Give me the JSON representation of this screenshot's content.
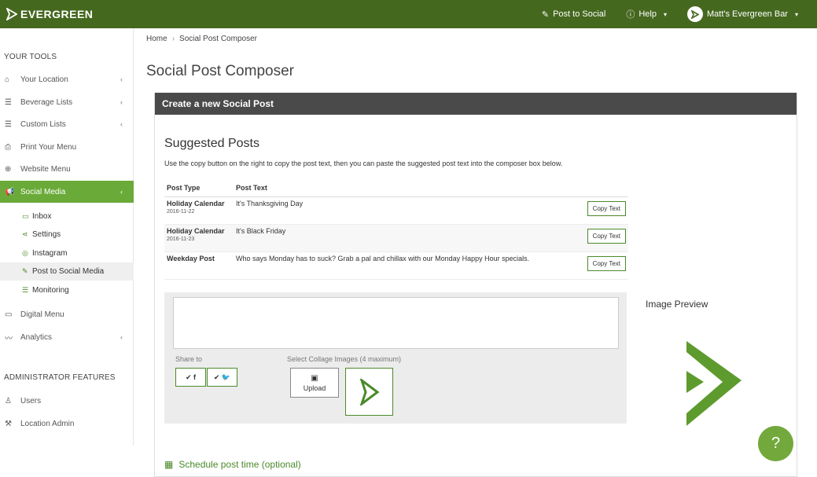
{
  "brand": {
    "name": "EVERGREEN"
  },
  "topnav": {
    "post_to_social": "Post to Social",
    "help": "Help",
    "account": "Matt's Evergreen Bar"
  },
  "sidebar": {
    "tools_title": "YOUR TOOLS",
    "items": [
      {
        "label": "Your Location",
        "icon": "home-icon"
      },
      {
        "label": "Beverage Lists",
        "icon": "list-icon"
      },
      {
        "label": "Custom Lists",
        "icon": "list-icon"
      },
      {
        "label": "Print Your Menu",
        "icon": "print-icon"
      },
      {
        "label": "Website Menu",
        "icon": "globe-icon"
      },
      {
        "label": "Social Media",
        "icon": "megaphone-icon"
      }
    ],
    "social_sub": [
      {
        "label": "Inbox",
        "icon": "inbox-icon"
      },
      {
        "label": "Settings",
        "icon": "share-icon"
      },
      {
        "label": "Instagram",
        "icon": "instagram-icon"
      },
      {
        "label": "Post to Social Media",
        "icon": "post-icon"
      },
      {
        "label": "Monitoring",
        "icon": "rss-icon"
      }
    ],
    "more_items": [
      {
        "label": "Digital Menu",
        "icon": "monitor-icon"
      },
      {
        "label": "Analytics",
        "icon": "chart-line-icon"
      }
    ],
    "admin_title": "ADMINISTRATOR FEATURES",
    "admin_items": [
      {
        "label": "Users",
        "icon": "users-icon"
      },
      {
        "label": "Location Admin",
        "icon": "wrench-icon"
      }
    ]
  },
  "breadcrumb": {
    "home": "Home",
    "current": "Social Post Composer"
  },
  "page": {
    "title": "Social Post Composer"
  },
  "panel": {
    "header": "Create a new Social Post"
  },
  "suggested": {
    "title": "Suggested Posts",
    "description": "Use the copy button on the right to copy the post text, then you can paste the suggested post text into the composer box below.",
    "col_type": "Post Type",
    "col_text": "Post Text",
    "copy_label": "Copy Text",
    "rows": [
      {
        "type": "Holiday Calendar",
        "date": "2016-11-22",
        "text": "It's Thanksgiving Day"
      },
      {
        "type": "Holiday Calendar",
        "date": "2016-11-23",
        "text": "It's Black Friday"
      },
      {
        "type": "Weekday Post",
        "date": "",
        "text": "Who says Monday has to suck? Grab a pal and chillax with our Monday Happy Hour specials."
      }
    ]
  },
  "composer": {
    "share_label": "Share to",
    "share_facebook": "✔ f",
    "share_twitter": "✔ 🐦",
    "collage_label": "Select Collage Images (4 maximum)",
    "upload_label": "Upload"
  },
  "preview": {
    "label": "Image Preview"
  },
  "schedule": {
    "label": "Schedule post time (optional)"
  },
  "help_fab": {
    "label": "?"
  },
  "colors": {
    "brand_green": "#45681f",
    "accent_green": "#6aaa38",
    "panel_header": "#4a4a4a"
  }
}
